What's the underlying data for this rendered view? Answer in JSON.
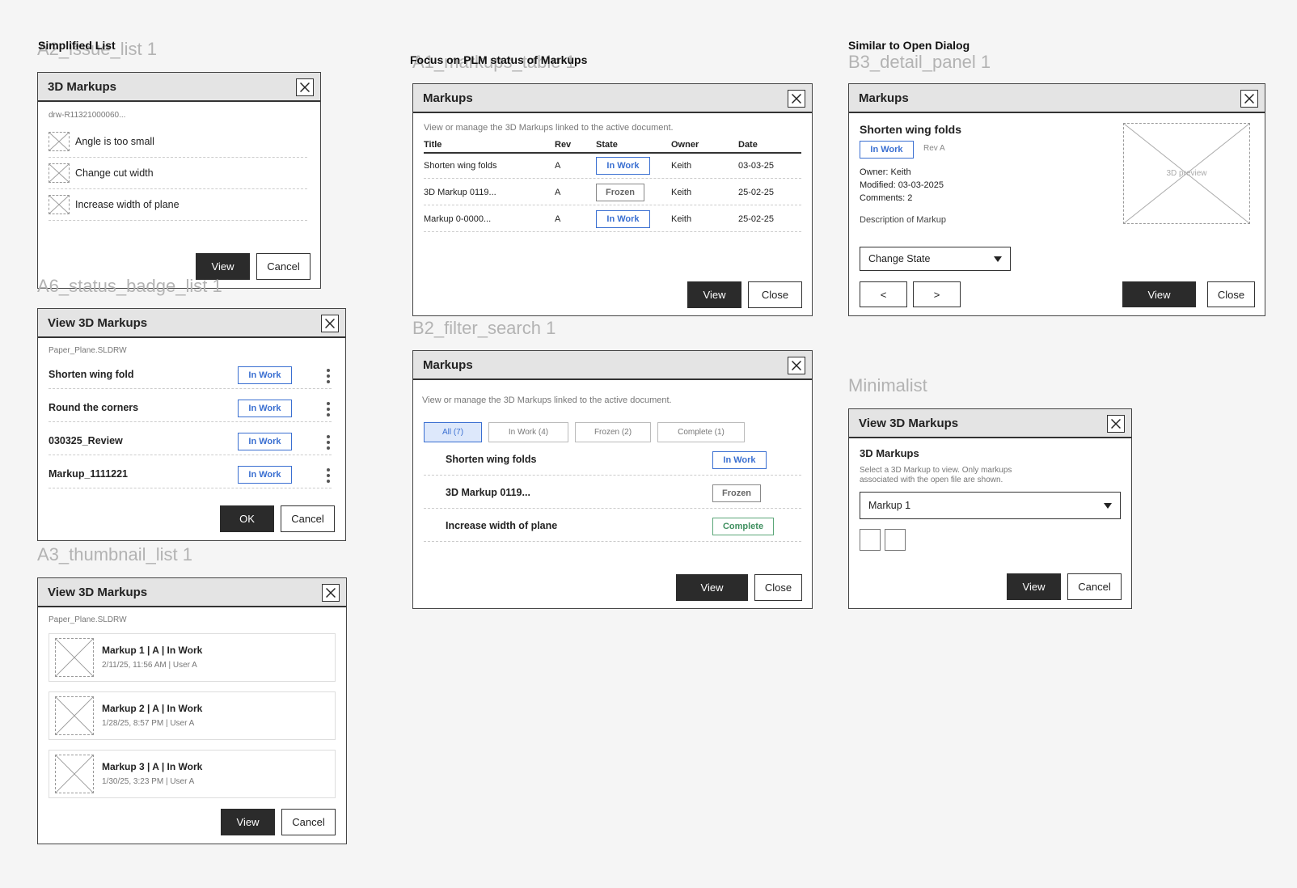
{
  "notes": {
    "simplified": "Simplified List",
    "plm": "Focus on PLM status of Markups",
    "open_dialog": "Similar to Open Dialog"
  },
  "frames": {
    "a2": "A2_issue_list 1",
    "a6": "A6_status_badge_list 1",
    "a3": "A3_thumbnail_list 1",
    "a1": "A1_markups_table 1",
    "b2": "B2_filter_search 1",
    "b3": "B3_detail_panel 1",
    "minimalist": "Minimalist"
  },
  "icons": {
    "close": "close-icon",
    "kebab": "kebab-menu-icon",
    "caret": "chevron-down-icon",
    "placeholder": "image-placeholder-icon"
  },
  "colors": {
    "in_work": "#3a6fd1",
    "frozen": "#888888",
    "complete": "#5aa678",
    "primary_button": "#2b2b2b"
  },
  "a2": {
    "title": "3D Markups",
    "file": "drw-R11321000060...",
    "items": [
      "Angle is too small",
      "Change cut width",
      "Increase width of plane"
    ],
    "view": "View",
    "cancel": "Cancel"
  },
  "a6": {
    "title": "View 3D Markups",
    "file": "Paper_Plane.SLDRW",
    "items": [
      {
        "name": "Shorten wing fold",
        "status": "In Work"
      },
      {
        "name": "Round the corners",
        "status": "In Work"
      },
      {
        "name": "030325_Review",
        "status": "In Work"
      },
      {
        "name": "Markup_1111221",
        "status": "In Work"
      }
    ],
    "ok": "OK",
    "cancel": "Cancel"
  },
  "a3": {
    "title": "View 3D Markups",
    "file": "Paper_Plane.SLDRW",
    "items": [
      {
        "title": "Markup 1 | A | In Work",
        "meta": "2/11/25, 11:56 AM | User A"
      },
      {
        "title": "Markup 2 | A | In Work",
        "meta": "1/28/25, 8:57 PM | User A"
      },
      {
        "title": "Markup 3 | A | In Work",
        "meta": "1/30/25, 3:23 PM | User A"
      }
    ],
    "view": "View",
    "cancel": "Cancel"
  },
  "a1": {
    "title": "Markups",
    "description": "View or manage the 3D Markups linked to the active document.",
    "columns": [
      "Title",
      "Rev",
      "State",
      "Owner",
      "Date"
    ],
    "rows": [
      {
        "title": "Shorten wing folds",
        "rev": "A",
        "state": "In Work",
        "owner": "Keith",
        "date": "03-03-25"
      },
      {
        "title": "3D Markup 0119...",
        "rev": "A",
        "state": "Frozen",
        "owner": "Keith",
        "date": "25-02-25"
      },
      {
        "title": "Markup 0-0000...",
        "rev": "A",
        "state": "In Work",
        "owner": "Keith",
        "date": "25-02-25"
      }
    ],
    "view": "View",
    "close": "Close"
  },
  "b2": {
    "title": "Markups",
    "description": "View or manage the 3D Markups linked to the active document.",
    "filters": [
      "All (7)",
      "In Work (4)",
      "Frozen (2)",
      "Complete (1)"
    ],
    "active_filter": "All (7)",
    "items": [
      {
        "name": "Shorten wing folds",
        "status": "In Work"
      },
      {
        "name": "3D Markup 0119...",
        "status": "Frozen"
      },
      {
        "name": "Increase width of plane",
        "status": "Complete"
      }
    ],
    "view": "View",
    "close": "Close"
  },
  "b3": {
    "title": "Markups",
    "markup_name": "Shorten wing folds",
    "status": "In Work",
    "rev": "Rev A",
    "owner": "Owner: Keith",
    "modified": "Modified: 03-03-2025",
    "comments": "Comments: 2",
    "description": "Description of Markup",
    "preview": "3D preview",
    "change_state": "Change State",
    "prev": "<",
    "next": ">",
    "view": "View",
    "close": "Close"
  },
  "minimalist": {
    "title": "View 3D Markups",
    "heading": "3D Markups",
    "help_line1": "Select a 3D Markup to view. Only markups",
    "help_line2": "associated with the open file are shown.",
    "selected": "Markup 1",
    "view": "View",
    "cancel": "Cancel"
  }
}
